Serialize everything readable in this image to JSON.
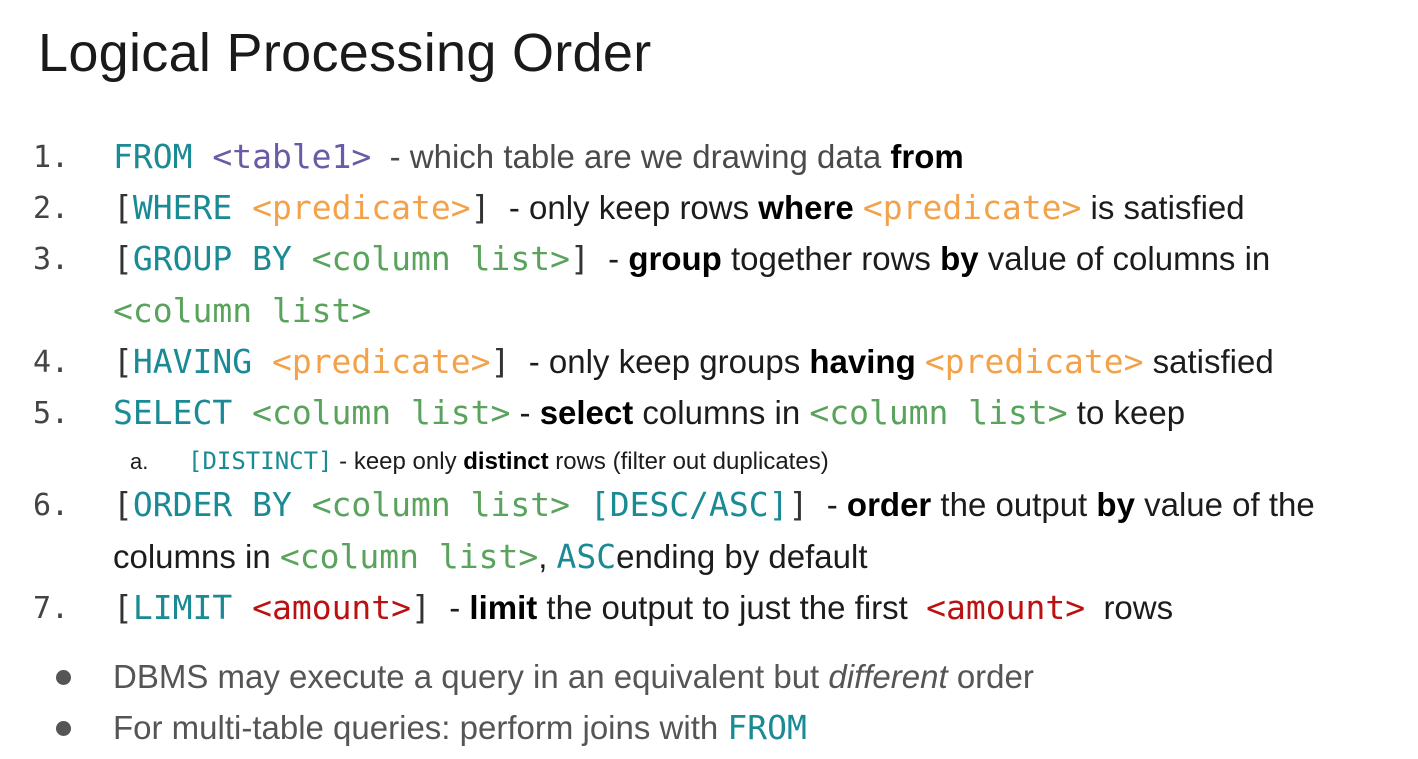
{
  "title": "Logical Processing Order",
  "items": [
    {
      "num": "1.",
      "parts": [
        {
          "t": "FROM ",
          "k": "teal",
          "code": true
        },
        {
          "t": "<table1>",
          "k": "purple",
          "code": true
        },
        {
          "t": "  - which table are we drawing data ",
          "k": "grey"
        },
        {
          "t": "from",
          "k": "b"
        }
      ]
    },
    {
      "num": "2.",
      "parts": [
        {
          "t": "[",
          "k": "dark",
          "code": true
        },
        {
          "t": "WHERE ",
          "k": "teal",
          "code": true
        },
        {
          "t": "<predicate>",
          "k": "orange",
          "code": true
        },
        {
          "t": "]",
          "k": "dark",
          "code": true
        },
        {
          "t": "  - only keep rows ",
          "k": "plain"
        },
        {
          "t": "where",
          "k": "b"
        },
        {
          "t": " ",
          "k": "plain"
        },
        {
          "t": "<predicate>",
          "k": "orange",
          "code": true
        },
        {
          "t": " is satisfied",
          "k": "plain"
        }
      ]
    },
    {
      "num": "3.",
      "parts": [
        {
          "t": "[",
          "k": "dark",
          "code": true
        },
        {
          "t": "GROUP BY ",
          "k": "teal",
          "code": true
        },
        {
          "t": "<column list>",
          "k": "green",
          "code": true
        },
        {
          "t": "]",
          "k": "dark",
          "code": true
        },
        {
          "t": "  - ",
          "k": "plain"
        },
        {
          "t": "group",
          "k": "b"
        },
        {
          "t": " together rows ",
          "k": "plain"
        },
        {
          "t": "by",
          "k": "b"
        },
        {
          "t": " value of columns in",
          "k": "plain"
        }
      ],
      "cont": [
        {
          "t": "<column list>",
          "k": "green",
          "code": true
        }
      ]
    },
    {
      "num": "4.",
      "parts": [
        {
          "t": "[",
          "k": "dark",
          "code": true
        },
        {
          "t": "HAVING ",
          "k": "teal",
          "code": true
        },
        {
          "t": "<predicate>",
          "k": "orange",
          "code": true
        },
        {
          "t": "]",
          "k": "dark",
          "code": true
        },
        {
          "t": "  - only keep groups ",
          "k": "plain"
        },
        {
          "t": "having",
          "k": "b"
        },
        {
          "t": " ",
          "k": "plain"
        },
        {
          "t": "<predicate>",
          "k": "orange",
          "code": true
        },
        {
          "t": " satisfied",
          "k": "plain"
        }
      ]
    },
    {
      "num": "5.",
      "parts": [
        {
          "t": "SELECT ",
          "k": "teal",
          "code": true
        },
        {
          "t": "<column list>",
          "k": "green",
          "code": true
        },
        {
          "t": " - ",
          "k": "plain"
        },
        {
          "t": "select",
          "k": "b"
        },
        {
          "t": " columns in ",
          "k": "plain"
        },
        {
          "t": "<column list>",
          "k": "green",
          "code": true
        },
        {
          "t": " to keep",
          "k": "plain"
        }
      ],
      "sub": {
        "num": "a.",
        "parts": [
          {
            "t": "[DISTINCT]",
            "k": "teal",
            "code": true
          },
          {
            "t": " - keep only ",
            "k": "plain"
          },
          {
            "t": "distinct",
            "k": "b"
          },
          {
            "t": " rows (filter out duplicates)",
            "k": "plain"
          }
        ]
      }
    },
    {
      "num": "6.",
      "parts": [
        {
          "t": "[",
          "k": "dark",
          "code": true
        },
        {
          "t": "ORDER BY ",
          "k": "teal",
          "code": true
        },
        {
          "t": "<column list>",
          "k": "green",
          "code": true
        },
        {
          "t": " ",
          "k": "plain",
          "code": true
        },
        {
          "t": "[DESC/ASC]",
          "k": "teal",
          "code": true
        },
        {
          "t": "]",
          "k": "dark",
          "code": true
        },
        {
          "t": "  - ",
          "k": "plain"
        },
        {
          "t": "order",
          "k": "b"
        },
        {
          "t": " the output ",
          "k": "plain"
        },
        {
          "t": "by",
          "k": "b"
        },
        {
          "t": " value of the",
          "k": "plain"
        }
      ],
      "cont": [
        {
          "t": "columns in ",
          "k": "plain"
        },
        {
          "t": "<column list>",
          "k": "green",
          "code": true
        },
        {
          "t": ", ",
          "k": "plain"
        },
        {
          "t": "ASC",
          "k": "teal",
          "code": true
        },
        {
          "t": "ending by default",
          "k": "plain"
        }
      ]
    },
    {
      "num": "7.",
      "parts": [
        {
          "t": "[",
          "k": "dark",
          "code": true
        },
        {
          "t": "LIMIT ",
          "k": "teal",
          "code": true
        },
        {
          "t": "<amount>",
          "k": "red",
          "code": true
        },
        {
          "t": "]",
          "k": "dark",
          "code": true
        },
        {
          "t": "  - ",
          "k": "plain"
        },
        {
          "t": "limit",
          "k": "b"
        },
        {
          "t": " the output to just the first  ",
          "k": "plain"
        },
        {
          "t": "<amount>",
          "k": "red",
          "code": true
        },
        {
          "t": "  rows",
          "k": "plain"
        }
      ]
    }
  ],
  "bullets": [
    {
      "parts": [
        {
          "t": "DBMS may execute a query in an equivalent but ",
          "k": "plain"
        },
        {
          "t": "different",
          "k": "i"
        },
        {
          "t": " order",
          "k": "plain"
        }
      ]
    },
    {
      "parts": [
        {
          "t": "For multi-table queries: perform joins with ",
          "k": "plain"
        },
        {
          "t": "FROM",
          "k": "teal",
          "code": true
        }
      ]
    }
  ]
}
